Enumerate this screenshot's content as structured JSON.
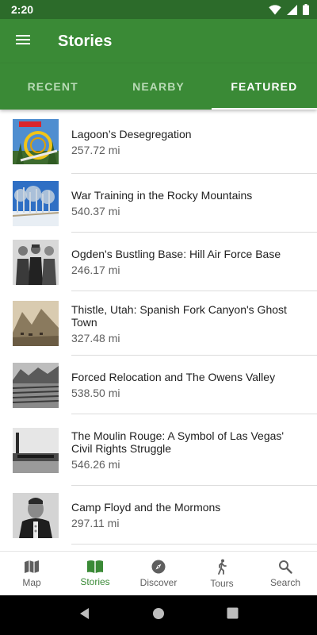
{
  "status_bar": {
    "time": "2:20"
  },
  "app_bar": {
    "title": "Stories"
  },
  "tabs": [
    {
      "label": "RECENT",
      "active": false
    },
    {
      "label": "NEARBY",
      "active": false
    },
    {
      "label": "FEATURED",
      "active": true
    }
  ],
  "stories": [
    {
      "title": "Lagoon’s Desegregation",
      "distance": "257.72 mi",
      "image": "rollercoaster-photo"
    },
    {
      "title": "War Training in the Rocky Mountains",
      "distance": "540.37 mi",
      "image": "snowy-trees-photo"
    },
    {
      "title": "Ogden's Bustling Base: Hill Air Force Base",
      "distance": "246.17 mi",
      "image": "three-men-photo"
    },
    {
      "title": "Thistle, Utah: Spanish Fork Canyon's Ghost Town",
      "distance": "327.48 mi",
      "image": "canyon-town-photo"
    },
    {
      "title": "Forced Relocation and The Owens Valley",
      "distance": "538.50 mi",
      "image": "camp-barracks-photo"
    },
    {
      "title": "The Moulin Rouge: A Symbol of Las Vegas' Civil Rights Struggle",
      "distance": "546.26 mi",
      "image": "casino-building-photo"
    },
    {
      "title": "Camp Floyd and the Mormons",
      "distance": "297.11 mi",
      "image": "general-portrait-photo"
    }
  ],
  "bottom_nav": [
    {
      "label": "Map",
      "icon": "map-icon",
      "active": false
    },
    {
      "label": "Stories",
      "icon": "book-icon",
      "active": true
    },
    {
      "label": "Discover",
      "icon": "compass-icon",
      "active": false
    },
    {
      "label": "Tours",
      "icon": "walking-icon",
      "active": false
    },
    {
      "label": "Search",
      "icon": "search-icon",
      "active": false
    }
  ],
  "colors": {
    "primary": "#3a8a36",
    "primary_dark": "#2c6b2a",
    "tab_inactive": "#b9dbb6",
    "nav_inactive": "#5f5f5f"
  }
}
